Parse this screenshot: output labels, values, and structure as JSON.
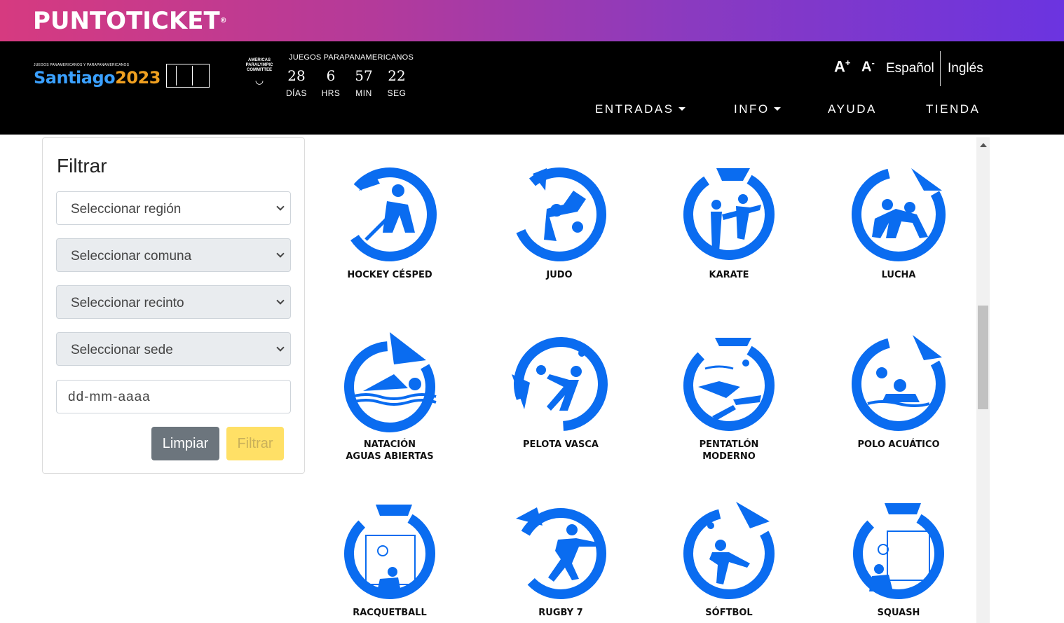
{
  "brand": {
    "name": "PUNTOTICKET",
    "reg": "®"
  },
  "header": {
    "event_logo_small": "JUEGOS PANAMERICANOS Y PARAPANAMERICANOS",
    "event_logo_city": "Santiago",
    "event_logo_year": "2023",
    "apc_logo_text": "AMERICAS PARALYMPIC COMMITTEE",
    "countdown_title": "JUEGOS PARAPANAMERICANOS",
    "countdown": [
      {
        "value": "28",
        "label": "DÍAS"
      },
      {
        "value": "6",
        "label": "HRS"
      },
      {
        "value": "57",
        "label": "MIN"
      },
      {
        "value": "22",
        "label": "SEG"
      }
    ],
    "font_increase": "A",
    "font_increase_sup": "+",
    "font_decrease": "A",
    "font_decrease_sup": "-",
    "lang_es": "Español",
    "lang_en": "Inglés",
    "nav": [
      "ENTRADAS",
      "INFO",
      "AYUDA",
      "TIENDA"
    ]
  },
  "filter": {
    "title": "Filtrar",
    "region": "Seleccionar región",
    "comuna": "Seleccionar comuna",
    "recinto": "Seleccionar recinto",
    "sede": "Seleccionar sede",
    "date_placeholder": "dd-mm-aaaa",
    "clear_label": "Limpiar",
    "filter_label": "Filtrar"
  },
  "sports": [
    {
      "name": "HOCKEY CÉSPED",
      "icon": "hockey-icon"
    },
    {
      "name": "JUDO",
      "icon": "judo-icon"
    },
    {
      "name": "KARATE",
      "icon": "karate-icon"
    },
    {
      "name": "LUCHA",
      "icon": "wrestling-icon"
    },
    {
      "name": "NATACIÓN\nAGUAS ABIERTAS",
      "icon": "swimming-icon"
    },
    {
      "name": "PELOTA VASCA",
      "icon": "basque-pelota-icon"
    },
    {
      "name": "PENTATLÓN\nMODERNO",
      "icon": "pentathlon-icon"
    },
    {
      "name": "POLO ACUÁTICO",
      "icon": "water-polo-icon"
    },
    {
      "name": "RACQUETBALL",
      "icon": "racquetball-icon"
    },
    {
      "name": "RUGBY 7",
      "icon": "rugby-icon"
    },
    {
      "name": "SÓFTBOL",
      "icon": "softball-icon"
    },
    {
      "name": "SQUASH",
      "icon": "squash-icon"
    }
  ],
  "colors": {
    "accent": "#0a6cf0",
    "brand_start": "#d63a80",
    "brand_end": "#6b34e0"
  }
}
